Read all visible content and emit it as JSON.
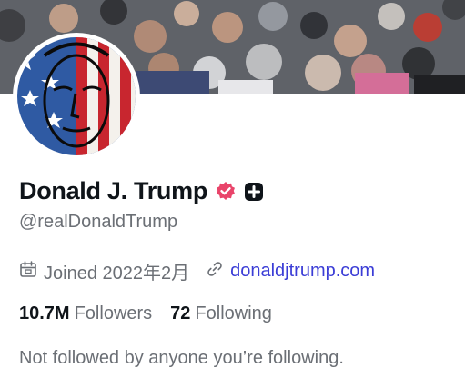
{
  "profile": {
    "display_name": "Donald J. Trump",
    "handle": "@realDonaldTrump",
    "joined": "Joined 2022年2月",
    "website": "donaldjtrump.com"
  },
  "stats": {
    "followers_count": "10.7M",
    "followers_label": "Followers",
    "following_count": "72",
    "following_label": "Following"
  },
  "mutuals_text": "Not followed by anyone you’re following.",
  "icons": {
    "verified": "verified-badge-icon",
    "plus": "plus-badge-icon",
    "calendar": "calendar-icon",
    "link": "link-icon"
  },
  "colors": {
    "verified_badge": "#e9446a",
    "link": "#3b3dd6",
    "name": "#0f1419",
    "muted": "#6b6f75"
  }
}
